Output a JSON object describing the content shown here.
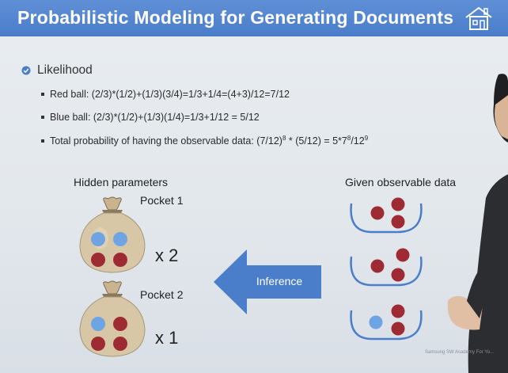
{
  "slide": {
    "title": "Probabilistic Modeling for Generating Documents",
    "heading": "Likelihood",
    "bullets": [
      {
        "text": "Red ball: (2/3)*(1/2)+(1/3)(3/4)=1/3+1/4=(4+3)/12=7/12"
      },
      {
        "text": "Blue ball: (2/3)*(1/2)+(1/3)(1/4)=1/3+1/12 = 5/12"
      },
      {
        "pre": "Total probability of having the observable data: (7/12)",
        "sup1": "8",
        "mid": " * (5/12) = 5*7",
        "sup2": "8",
        "mid2": "/12",
        "sup3": "9"
      }
    ],
    "hidden_label": "Hidden parameters",
    "observable_label": "Given observable data",
    "pocket1": "Pocket 1",
    "pocket2": "Pocket 2",
    "pocket1_multiplier": "x 2",
    "pocket2_multiplier": "x 1",
    "arrow_label": "Inference",
    "footer": "Samsung SW Academy For Yo..."
  },
  "colors": {
    "title_bar": "#4a7dca",
    "ball_red": "#9e2a33",
    "ball_blue": "#6ea4e4",
    "arrow": "#4a7dca"
  }
}
